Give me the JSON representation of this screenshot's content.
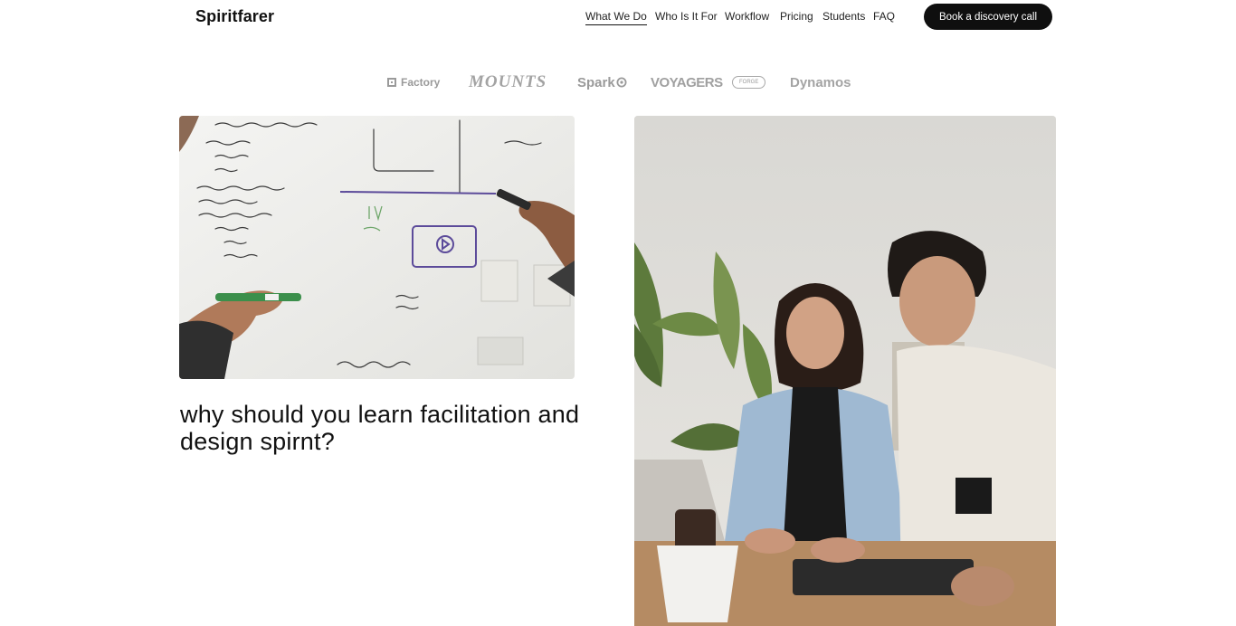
{
  "header": {
    "brand": "Spiritfarer",
    "nav": [
      {
        "label": "What We Do",
        "active": true
      },
      {
        "label": "Who Is It For",
        "active": false
      },
      {
        "label": "Workflow",
        "active": false
      },
      {
        "label": "Pricing",
        "active": false
      },
      {
        "label": "Students",
        "active": false
      },
      {
        "label": "FAQ",
        "active": false
      }
    ],
    "cta_label": "Book a discovery call"
  },
  "logos": {
    "factory": "Factory",
    "mounts": "MOUNTS",
    "spark": "Spark",
    "voyagers": "VOYAGERS",
    "forge": "FORGE",
    "dynamos": "Dynamos"
  },
  "images": {
    "left": "whiteboard-planning-photo",
    "right": "two-people-at-laptop-photo"
  },
  "main": {
    "headline": "why should you learn facilitation and design spirnt?"
  },
  "colors": {
    "cta_bg": "#0f0f0f",
    "logo_gray": "#9a9a9a",
    "text": "#111111"
  }
}
